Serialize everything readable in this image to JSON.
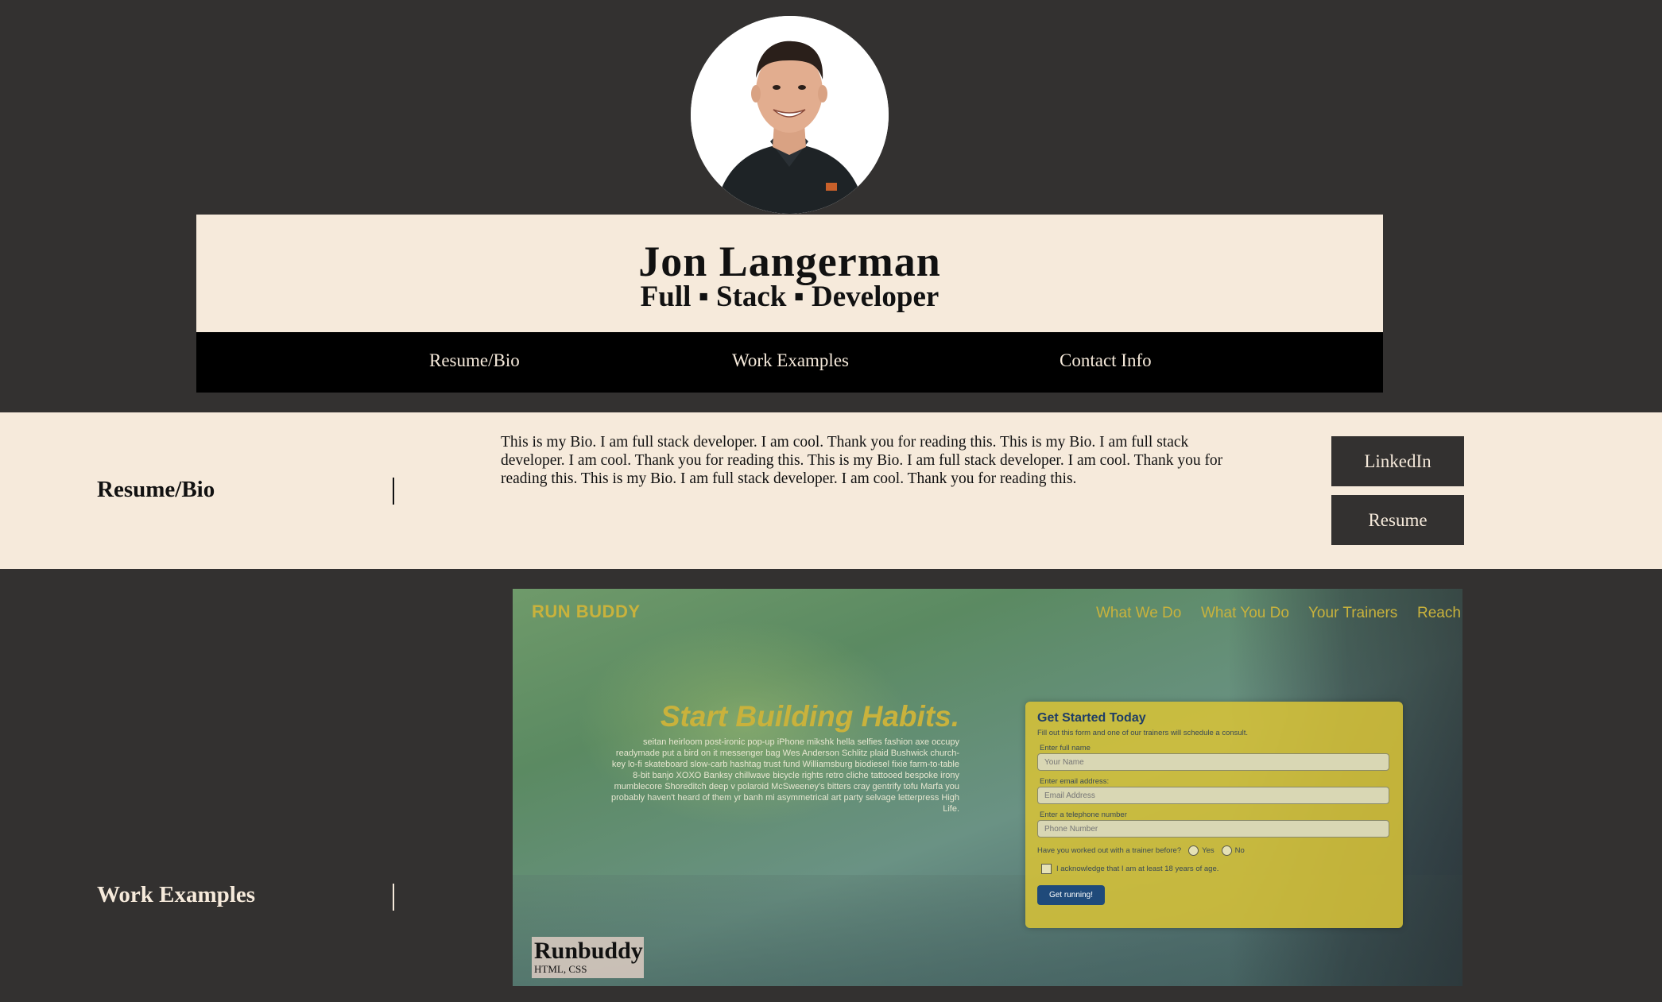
{
  "header": {
    "name": "Jon Langerman",
    "tagline": "Full ▪ Stack ▪ Developer"
  },
  "nav": {
    "items": [
      "Resume/Bio",
      "Work Examples",
      "Contact Info"
    ]
  },
  "bio": {
    "heading": "Resume/Bio",
    "text": "This is my Bio. I am full stack developer. I am cool. Thank you for reading this. This is my Bio. I am full stack developer. I am cool. Thank you for reading this. This is my Bio. I am full stack developer. I am cool. Thank you for reading this. This is my Bio. I am full stack developer. I am cool. Thank you for reading this.",
    "buttons": {
      "linkedin": "LinkedIn",
      "resume": "Resume"
    }
  },
  "work": {
    "heading": "Work Examples",
    "project": {
      "name": "Runbuddy",
      "tech": "HTML, CSS",
      "screenshot": {
        "logo": "RUN BUDDY",
        "nav": [
          "What We Do",
          "What You Do",
          "Your Trainers",
          "Reach"
        ],
        "hero_title": "Start Building Habits.",
        "hero_text": "seitan heirloom post-ironic pop-up iPhone mikshk hella selfies fashion axe occupy readymade put a bird on it messenger bag Wes Anderson Schlitz plaid Bushwick church-key lo-fi skateboard slow-carb hashtag trust fund Williamsburg biodiesel fixie farm-to-table 8-bit banjo XOXO Banksy chillwave bicycle rights retro cliche tattooed bespoke irony mumblecore Shoreditch deep v polaroid McSweeney's bitters cray gentrify tofu Marfa you probably haven't heard of them yr banh mi asymmetrical art party selvage letterpress High Life.",
        "form": {
          "title": "Get Started Today",
          "subtitle": "Fill out this form and one of our trainers will schedule a consult.",
          "name_label": "Enter full name",
          "name_placeholder": "Your Name",
          "email_label": "Enter email address:",
          "email_placeholder": "Email Address",
          "phone_label": "Enter a telephone number",
          "phone_placeholder": "Phone Number",
          "trainer_question": "Have you worked out with a trainer before?",
          "yes": "Yes",
          "no": "No",
          "acknowledge": "I acknowledge that I am at least 18 years of age.",
          "submit": "Get running!"
        }
      }
    }
  },
  "colors": {
    "background": "#333130",
    "cream": "#f6eadb",
    "nav_black": "#000000",
    "accent_gold": "#c9b23c"
  }
}
